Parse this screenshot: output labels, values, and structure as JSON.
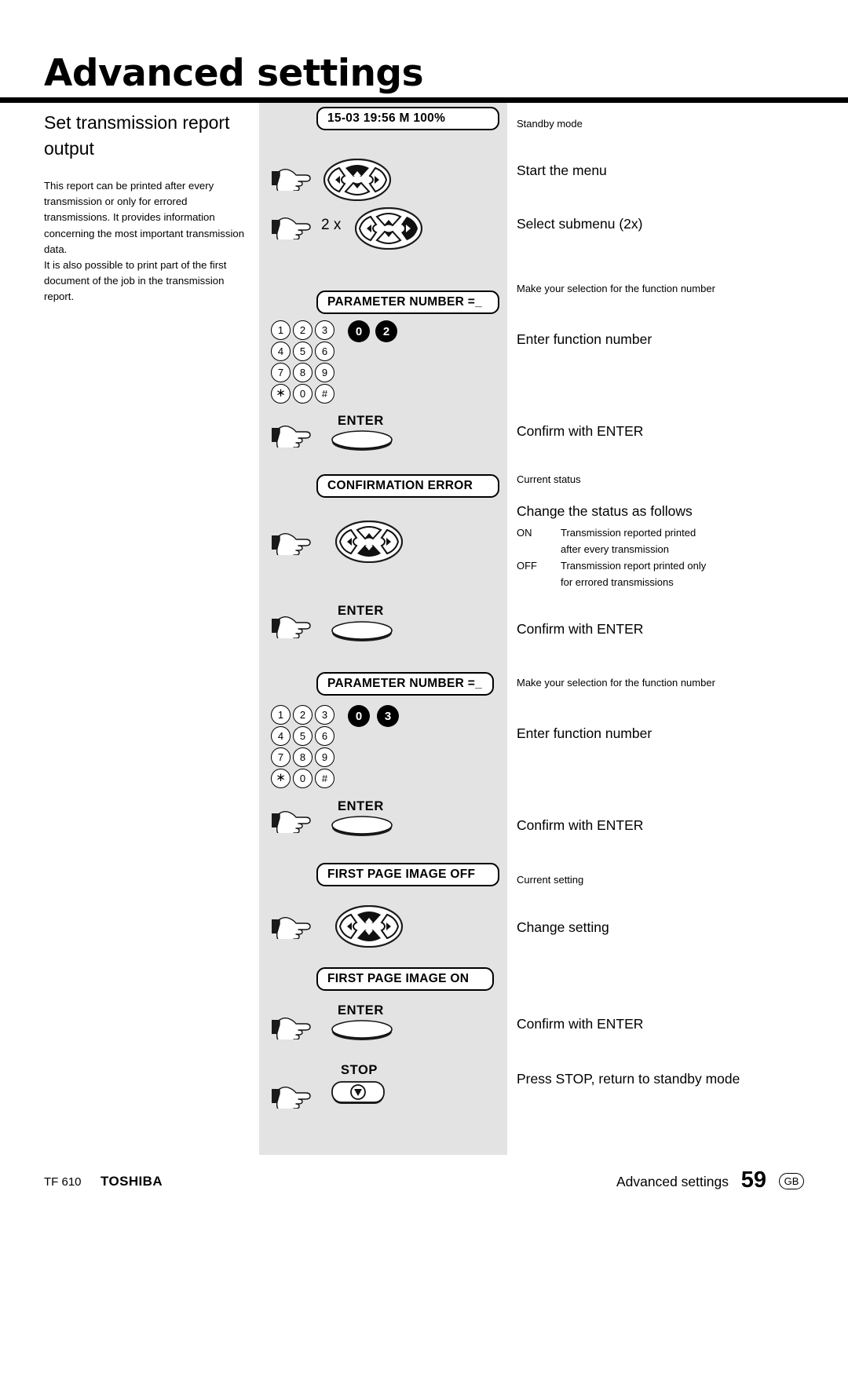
{
  "header": {
    "title": "Advanced settings"
  },
  "left": {
    "section_title": "Set  transmission  report output",
    "paragraph1": "This report can be printed after every transmission or only for errored transmissions. It provides information concerning the most important transmission data.",
    "paragraph2": "It is also possible to print part of the first document of the job in the transmission report."
  },
  "steps": {
    "standby_mode": "Standby mode",
    "start_menu": "Start the menu",
    "select_submenu": "Select submenu (2x)",
    "make_selection_1": "Make your selection for the function number",
    "enter_function_number_1": "Enter function number",
    "confirm_enter_1": "Confirm with ENTER",
    "current_status": "Current status",
    "change_status_heading": "Change the status as follows",
    "confirm_enter_2": "Confirm with ENTER",
    "make_selection_2": "Make your selection for the function number",
    "enter_function_number_2": "Enter function number",
    "confirm_enter_3": "Confirm with ENTER",
    "current_setting": "Current setting",
    "change_setting": "Change setting",
    "confirm_enter_4": "Confirm with ENTER",
    "press_stop": "Press STOP, return to standby mode"
  },
  "status_options": [
    {
      "key": "ON",
      "line1": "Transmission reported printed",
      "line2": "after every transmission"
    },
    {
      "key": "OFF",
      "line1": "Transmission report printed only",
      "line2": "for errored transmissions"
    }
  ],
  "displays": {
    "standby": "15-03 19:56  M 100%",
    "parameter_number_1": "PARAMETER NUMBER =_",
    "confirmation_error": "CONFIRMATION   ERROR",
    "parameter_number_2": "PARAMETER NUMBER =_",
    "first_page_image_off": "FIRST PAGE IMAGE OFF",
    "first_page_image_on": "FIRST PAGE IMAGE ON"
  },
  "controls": {
    "repeat_2x": "2 x",
    "enter_label_1": "ENTER",
    "enter_label_2": "ENTER",
    "enter_label_3": "ENTER",
    "enter_label_4": "ENTER",
    "stop_label": "STOP"
  },
  "keypad": {
    "rows": [
      [
        "1",
        "2",
        "3"
      ],
      [
        "4",
        "5",
        "6"
      ],
      [
        "7",
        "8",
        "9"
      ],
      [
        "∗",
        "0",
        "#"
      ]
    ],
    "highlight_1": [
      "0",
      "2"
    ],
    "highlight_2": [
      "0",
      "3"
    ]
  },
  "footer": {
    "model": "TF 610",
    "brand": "TOSHIBA",
    "section": "Advanced settings",
    "page_number": "59",
    "region_code": "GB"
  },
  "colors": {
    "panel_gray": "#e3e3e3",
    "ink": "#000000",
    "paper": "#ffffff"
  }
}
